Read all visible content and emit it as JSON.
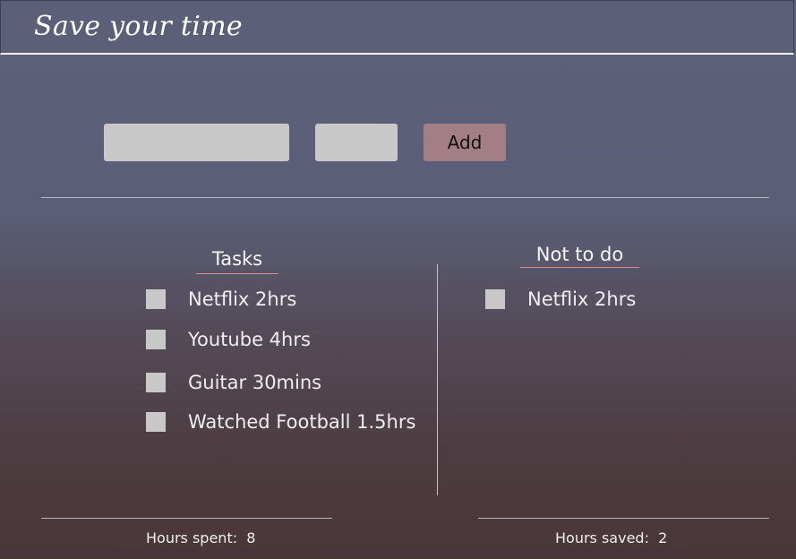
{
  "header": {
    "title": "Save your time"
  },
  "form": {
    "task_value": "",
    "hours_value": "",
    "add_label": "Add"
  },
  "tasks": {
    "title": "Tasks",
    "items": [
      {
        "label": "Netflix 2hrs"
      },
      {
        "label": "Youtube 4hrs"
      },
      {
        "label": "Guitar 30mins"
      },
      {
        "label": "Watched Football 1.5hrs"
      }
    ]
  },
  "not_to_do": {
    "title": "Not to do",
    "items": [
      {
        "label": "Netflix 2hrs"
      }
    ]
  },
  "footer": {
    "hours_spent_label": "Hours spent:",
    "hours_spent_value": "8",
    "hours_saved_label": "Hours saved:",
    "hours_saved_value": "2"
  },
  "colors": {
    "accent_button": "#a17f84",
    "underline": "#d98a8e",
    "input_bg": "#c8c8c8"
  }
}
